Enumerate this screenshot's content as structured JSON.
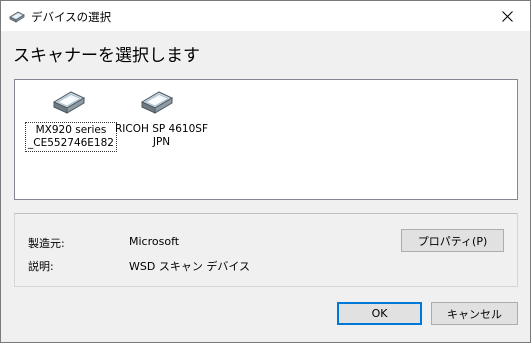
{
  "window": {
    "title": "デバイスの選択",
    "icons": {
      "app": "scanner-icon",
      "close": "close-icon"
    }
  },
  "heading": "スキャナーを選択します",
  "devices": [
    {
      "line1": "MX920 series",
      "line2": "_CE552746E182",
      "icon": "scanner-icon",
      "selected": true
    },
    {
      "line1": "RICOH SP 4610SF",
      "line2": "JPN",
      "icon": "scanner-icon",
      "selected": false
    }
  ],
  "info": {
    "manufacturer_label": "製造元:",
    "manufacturer_value": "Microsoft",
    "description_label": "説明:",
    "description_value": "WSD スキャン デバイス",
    "properties_button": "プロパティ(P)"
  },
  "footer": {
    "ok_button": "OK",
    "cancel_button": "キャンセル"
  },
  "colors": {
    "accent": "#0078d7",
    "dialog_bg": "#f0f0f0",
    "list_bg": "#ffffff",
    "button_bg": "#e1e1e1"
  }
}
